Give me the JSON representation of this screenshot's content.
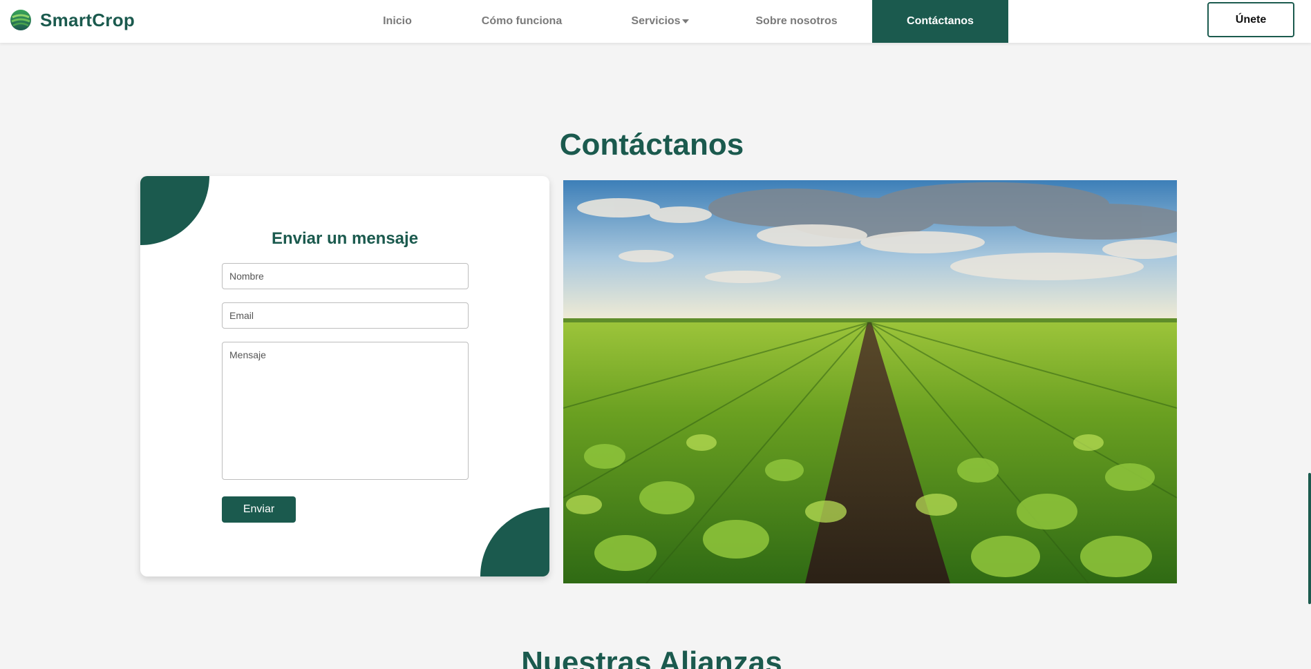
{
  "brand": {
    "name": "SmartCrop",
    "logo_icon": "smartcrop-leaf-logo",
    "color": "#1b5a4e"
  },
  "nav": {
    "items": [
      {
        "label": "Inicio",
        "active": false
      },
      {
        "label": "Cómo funciona",
        "active": false
      },
      {
        "label": "Servicios",
        "active": false,
        "dropdown": true
      },
      {
        "label": "Sobre nosotros",
        "active": false
      },
      {
        "label": "Contáctanos",
        "active": true
      }
    ],
    "join_label": "Únete"
  },
  "contact": {
    "title": "Contáctanos",
    "form_title": "Enviar un mensaje",
    "name_placeholder": "Nombre",
    "email_placeholder": "Email",
    "message_placeholder": "Mensaje",
    "send_label": "Enviar",
    "image": "soybean-field-photo"
  },
  "alliances": {
    "title": "Nuestras Alianzas"
  },
  "colors": {
    "accent": "#1b5a4e",
    "background": "#f4f4f4",
    "nav_text": "#7a7a7a"
  }
}
